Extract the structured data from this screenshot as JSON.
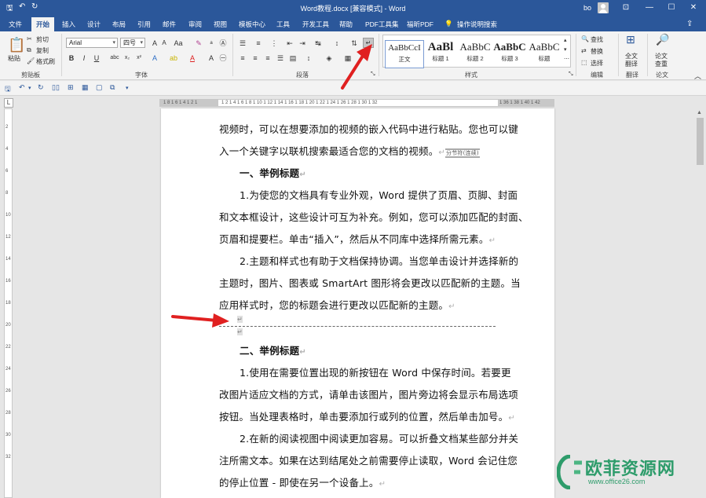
{
  "window": {
    "title": "Word教程.docx [兼容模式] - Word",
    "user": "bo",
    "controls": {
      "ribbon_opts": "⊡",
      "minimize": "—",
      "maximize": "☐",
      "close": "✕"
    }
  },
  "tabs": [
    {
      "label": "文件"
    },
    {
      "label": "开始"
    },
    {
      "label": "插入"
    },
    {
      "label": "设计"
    },
    {
      "label": "布局"
    },
    {
      "label": "引用"
    },
    {
      "label": "邮件"
    },
    {
      "label": "审阅"
    },
    {
      "label": "视图"
    },
    {
      "label": "模板中心"
    },
    {
      "label": "工具"
    },
    {
      "label": "开发工具"
    },
    {
      "label": "帮助"
    },
    {
      "label": "PDF工具集"
    },
    {
      "label": "福昕PDF"
    },
    {
      "label": "操作说明搜索"
    }
  ],
  "ribbon": {
    "clipboard": {
      "paste": "粘贴",
      "cut": "剪切",
      "copy": "复制",
      "format_painter": "格式刷",
      "group": "剪贴板"
    },
    "font": {
      "name": "Arial",
      "size": "四号",
      "group": "字体"
    },
    "paragraph": {
      "group": "段落"
    },
    "styles": {
      "group": "样式",
      "items": [
        {
          "preview": "AaBbCcI",
          "label": "正文"
        },
        {
          "preview": "AaBl",
          "label": "标题 1"
        },
        {
          "preview": "AaBbC",
          "label": "标题 2"
        },
        {
          "preview": "AaBbC",
          "label": "标题 3"
        },
        {
          "preview": "AaBbC",
          "label": "标题"
        }
      ]
    },
    "editing": {
      "find": "查找",
      "replace": "替换",
      "select": "选择",
      "group": "编辑"
    },
    "translate": {
      "label1": "全文",
      "label2": "翻译",
      "group": "翻译"
    },
    "paper": {
      "label1": "论文",
      "label2": "查重",
      "group": "论文"
    }
  },
  "document": {
    "lines": [
      {
        "text": "视频时，可以在想要添加的视频的嵌入代码中进行粘贴。您也可以键",
        "indent": false,
        "heading": false,
        "mark": ""
      },
      {
        "text": "入一个关键字以联机搜索最适合您的文档的视频。",
        "indent": false,
        "heading": false,
        "mark": "↵",
        "section_break": "分节符(连续)"
      },
      {
        "text": "一、举例标题",
        "indent": true,
        "heading": true,
        "mark": "↵"
      },
      {
        "text": "1.为使您的文档具有专业外观，Word 提供了页眉、页脚、封面",
        "indent": true,
        "heading": false,
        "mark": ""
      },
      {
        "text": "和文本框设计，这些设计可互为补充。例如，您可以添加匹配的封面、",
        "indent": false,
        "heading": false,
        "mark": ""
      },
      {
        "text": "页眉和提要栏。单击“插入”，然后从不同库中选择所需元素。",
        "indent": false,
        "heading": false,
        "mark": "↵"
      },
      {
        "text": "2.主题和样式也有助于文档保持协调。当您单击设计并选择新的",
        "indent": true,
        "heading": false,
        "mark": ""
      },
      {
        "text": "主题时，图片、图表或 SmartArt 图形将会更改以匹配新的主题。当",
        "indent": false,
        "heading": false,
        "mark": ""
      },
      {
        "text": "应用样式时，您的标题会进行更改以匹配新的主题。",
        "indent": false,
        "heading": false,
        "mark": "↵"
      },
      {
        "text": "二、举例标题",
        "indent": true,
        "heading": true,
        "mark": "↵"
      },
      {
        "text": "1.使用在需要位置出现的新按钮在 Word 中保存时间。若要更",
        "indent": true,
        "heading": false,
        "mark": ""
      },
      {
        "text": "改图片适应文档的方式，请单击该图片，图片旁边将会显示布局选项",
        "indent": false,
        "heading": false,
        "mark": ""
      },
      {
        "text": "按钮。当处理表格时，单击要添加行或列的位置，然后单击加号。",
        "indent": false,
        "heading": false,
        "mark": "↵"
      },
      {
        "text": "2.在新的阅读视图中阅读更加容易。可以折叠文档某些部分并关",
        "indent": true,
        "heading": false,
        "mark": ""
      },
      {
        "text": "注所需文本。如果在达到结尾处之前需要停止读取，Word 会记住您",
        "indent": false,
        "heading": false,
        "mark": ""
      },
      {
        "text": "的停止位置 - 即使在另一个设备上。",
        "indent": false,
        "heading": false,
        "mark": "↵"
      }
    ],
    "break_marks": [
      "↵",
      "↵"
    ]
  },
  "watermark": {
    "text": "欧菲资源网",
    "url": "www.office26.com"
  },
  "colors": {
    "accent": "#2b579a",
    "arrow": "#e02020",
    "watermark": "#2e9c6b"
  }
}
